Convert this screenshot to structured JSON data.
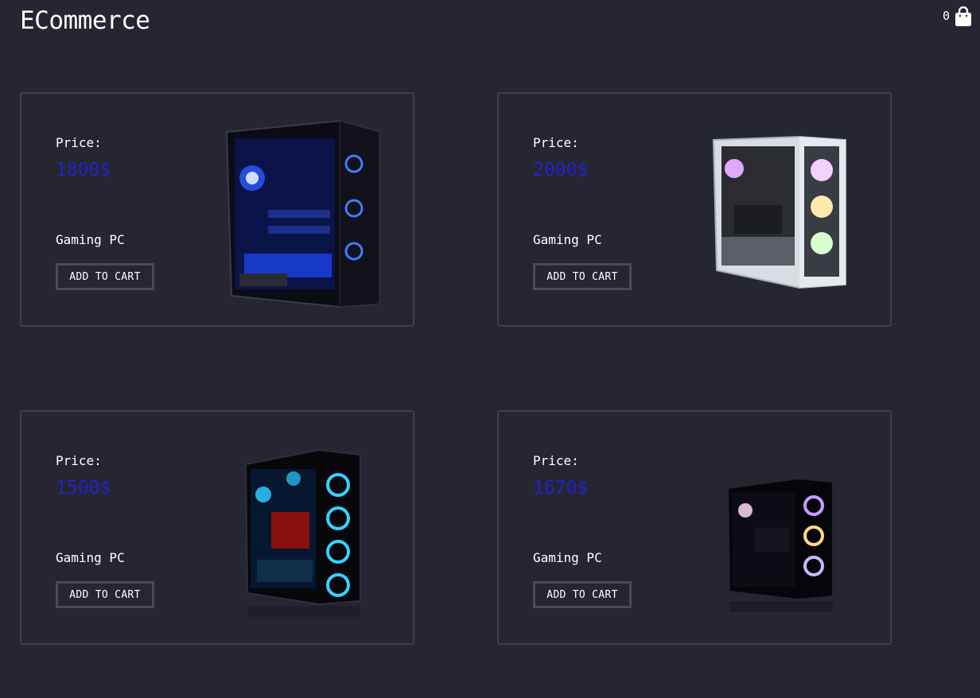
{
  "header": {
    "brand": "ECommerce",
    "cart_count": "0",
    "cart_icon": "shopping-bag-icon"
  },
  "colors": {
    "background": "#262632",
    "price": "#2323c6",
    "border": "#3e3e4c"
  },
  "products": [
    {
      "price_label": "Price:",
      "price": "1800$",
      "name": "Gaming PC",
      "button": "ADD TO CART",
      "image": "gaming-pc-blue-image"
    },
    {
      "price_label": "Price:",
      "price": "2000$",
      "name": "Gaming PC",
      "button": "ADD TO CART",
      "image": "gaming-pc-white-image"
    },
    {
      "price_label": "Price:",
      "price": "1500$",
      "name": "Gaming PC",
      "button": "ADD TO CART",
      "image": "gaming-pc-black-blue-image"
    },
    {
      "price_label": "Price:",
      "price": "1670$",
      "name": "Gaming PC",
      "button": "ADD TO CART",
      "image": "gaming-pc-black-rgb-image"
    }
  ]
}
